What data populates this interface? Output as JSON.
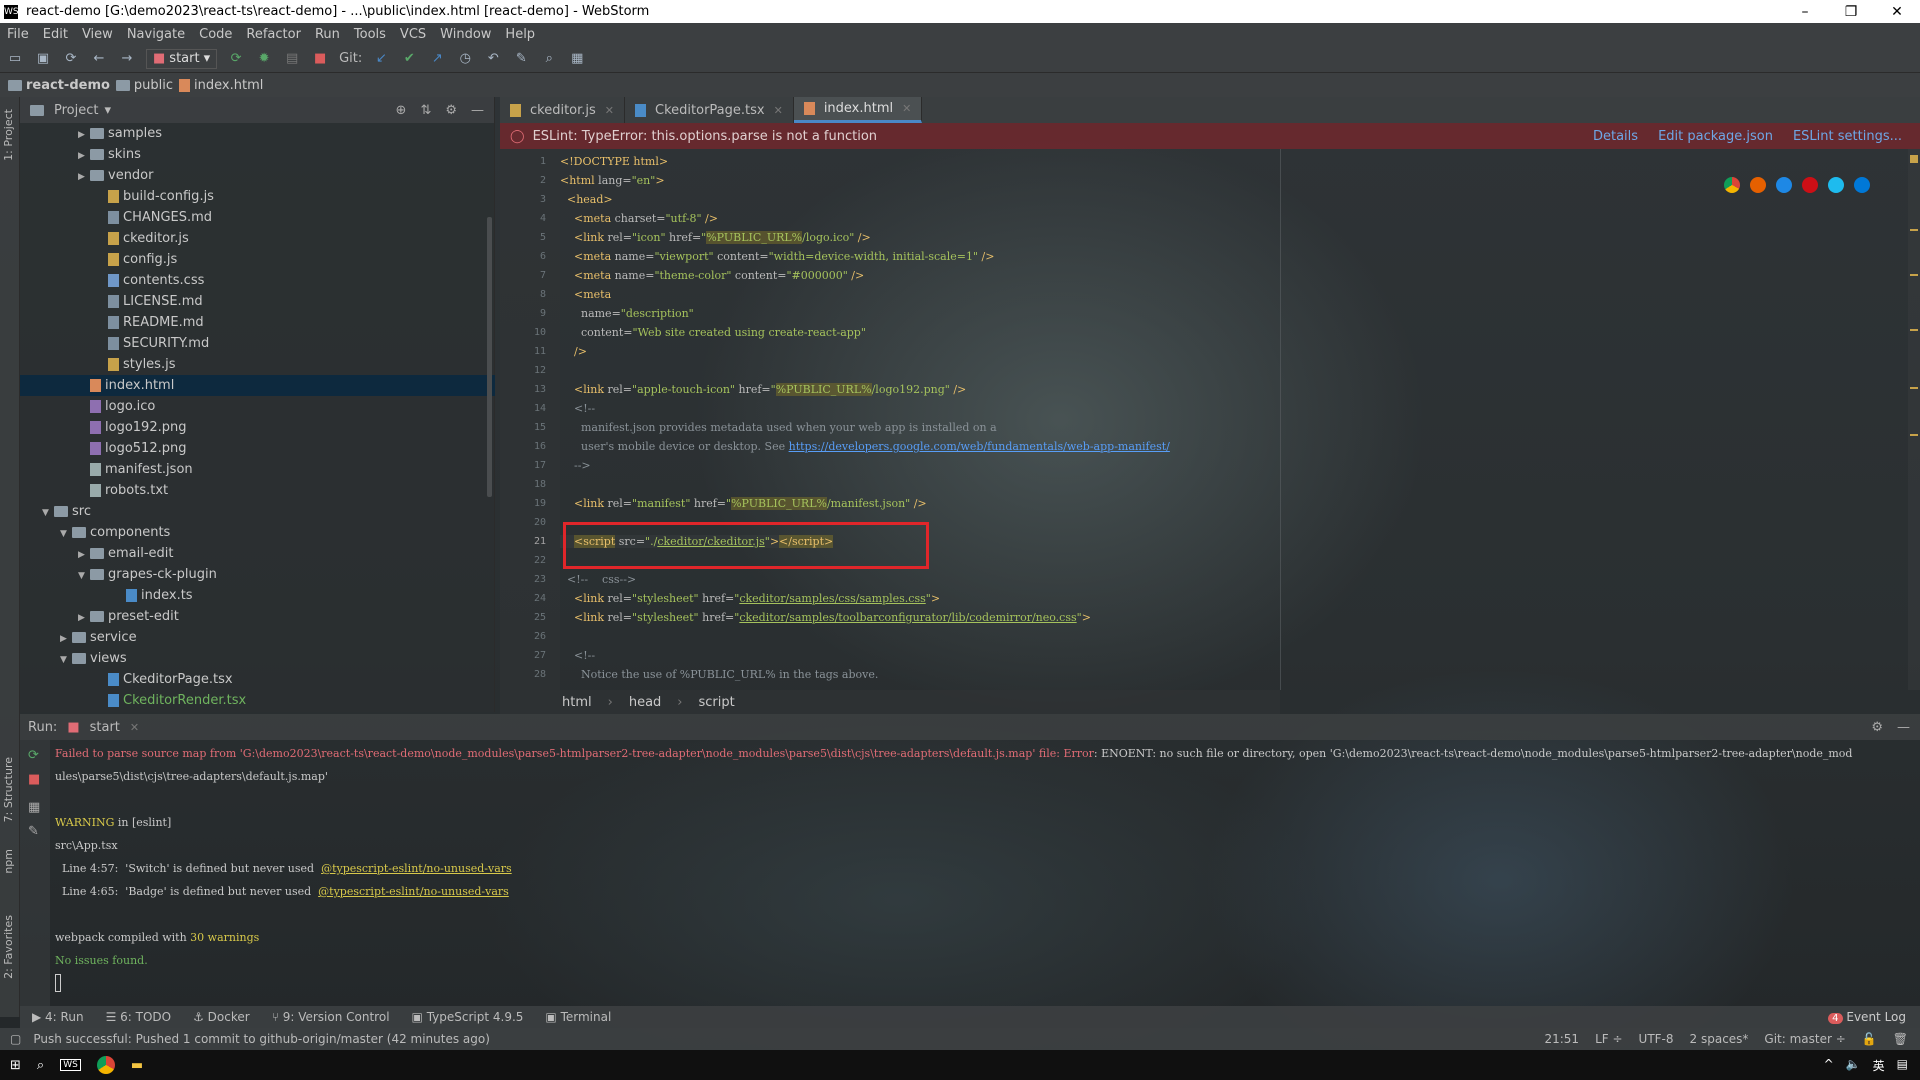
{
  "window": {
    "title": "react-demo [G:\\demo2023\\react-ts\\react-demo] - ...\\public\\index.html [react-demo] - WebStorm",
    "app_icon": "WS"
  },
  "menu": [
    "File",
    "Edit",
    "View",
    "Navigate",
    "Code",
    "Refactor",
    "Run",
    "Tools",
    "VCS",
    "Window",
    "Help"
  ],
  "toolbar": {
    "run_config": "start",
    "git_label": "Git:"
  },
  "breadcrumb": [
    "react-demo",
    "public",
    "index.html"
  ],
  "project": {
    "title": "Project",
    "rows": [
      {
        "label": "samples",
        "type": "folder",
        "depth": 3,
        "arrow": "▶"
      },
      {
        "label": "skins",
        "type": "folder",
        "depth": 3,
        "arrow": "▶"
      },
      {
        "label": "vendor",
        "type": "folder",
        "depth": 3,
        "arrow": "▶"
      },
      {
        "label": "build-config.js",
        "type": "js",
        "depth": 4,
        "arrow": ""
      },
      {
        "label": "CHANGES.md",
        "type": "md",
        "depth": 4,
        "arrow": ""
      },
      {
        "label": "ckeditor.js",
        "type": "js",
        "depth": 4,
        "arrow": ""
      },
      {
        "label": "config.js",
        "type": "js",
        "depth": 4,
        "arrow": ""
      },
      {
        "label": "contents.css",
        "type": "css",
        "depth": 4,
        "arrow": ""
      },
      {
        "label": "LICENSE.md",
        "type": "md",
        "depth": 4,
        "arrow": ""
      },
      {
        "label": "README.md",
        "type": "md",
        "depth": 4,
        "arrow": ""
      },
      {
        "label": "SECURITY.md",
        "type": "md",
        "depth": 4,
        "arrow": ""
      },
      {
        "label": "styles.js",
        "type": "js",
        "depth": 4,
        "arrow": ""
      },
      {
        "label": "index.html",
        "type": "html",
        "depth": 3,
        "arrow": "",
        "selected": true
      },
      {
        "label": "logo.ico",
        "type": "png",
        "depth": 3,
        "arrow": ""
      },
      {
        "label": "logo192.png",
        "type": "png",
        "depth": 3,
        "arrow": ""
      },
      {
        "label": "logo512.png",
        "type": "png",
        "depth": 3,
        "arrow": ""
      },
      {
        "label": "manifest.json",
        "type": "txt",
        "depth": 3,
        "arrow": ""
      },
      {
        "label": "robots.txt",
        "type": "txt",
        "depth": 3,
        "arrow": ""
      },
      {
        "label": "src",
        "type": "folder",
        "depth": 1,
        "arrow": "▼"
      },
      {
        "label": "components",
        "type": "folder",
        "depth": 2,
        "arrow": "▼"
      },
      {
        "label": "email-edit",
        "type": "folder",
        "depth": 3,
        "arrow": "▶"
      },
      {
        "label": "grapes-ck-plugin",
        "type": "folder",
        "depth": 3,
        "arrow": "▼"
      },
      {
        "label": "index.ts",
        "type": "tsx",
        "depth": 5,
        "arrow": ""
      },
      {
        "label": "preset-edit",
        "type": "folder",
        "depth": 3,
        "arrow": "▶"
      },
      {
        "label": "service",
        "type": "folder",
        "depth": 2,
        "arrow": "▶"
      },
      {
        "label": "views",
        "type": "folder",
        "depth": 2,
        "arrow": "▼"
      },
      {
        "label": "CkeditorPage.tsx",
        "type": "tsx",
        "depth": 4,
        "arrow": ""
      },
      {
        "label": "CkeditorRender.tsx",
        "type": "tsx",
        "depth": 4,
        "arrow": ""
      }
    ]
  },
  "tabs": [
    {
      "label": "ckeditor.js",
      "type": "js",
      "active": false
    },
    {
      "label": "CkeditorPage.tsx",
      "type": "tsx",
      "active": false
    },
    {
      "label": "index.html",
      "type": "html",
      "active": true
    }
  ],
  "eslint": {
    "message": "ESLint: TypeError: this.options.parse is not a function",
    "links": [
      "Details",
      "Edit package.json",
      "ESLint settings..."
    ]
  },
  "code_lines": [
    "1",
    "2",
    "3",
    "4",
    "5",
    "6",
    "7",
    "8",
    "9",
    "10",
    "11",
    "12",
    "13",
    "14",
    "15",
    "16",
    "17",
    "18",
    "19",
    "20",
    "21",
    "22",
    "23",
    "24",
    "25",
    "26",
    "27",
    "28"
  ],
  "editor_breadcrumb": [
    "html",
    "head",
    "script"
  ],
  "run": {
    "label": "Run:",
    "config": "start",
    "console": {
      "err1a": "Failed to parse source map from 'G:\\demo2023\\react-ts\\react-demo\\node_modules\\parse5-htmlparser2-tree-adapter\\node_modules\\parse5\\dist\\cjs\\tree-adapters\\default.js.map' file: ",
      "err1b": "Error",
      "err1c": ": ENOENT: no such file or directory, open 'G:\\demo2023\\react-ts\\react-demo\\node_modules\\parse5-htmlparser2-tree-adapter\\node_mod",
      "err2": "ules\\parse5\\dist\\cjs\\tree-adapters\\default.js.map'",
      "warning": "WARNING",
      "warning_rest": " in [eslint]",
      "file": "src\\App.tsx",
      "line1": "  Line 4:57:  'Switch' is defined but never used  ",
      "line1_rule": "@typescript-eslint/no-unused-vars",
      "line2": "  Line 4:65:  'Badge' is defined but never used  ",
      "line2_rule": "@typescript-eslint/no-unused-vars",
      "compiled_a": "webpack compiled with ",
      "compiled_b": "30 warnings",
      "no_issues": "No issues found."
    }
  },
  "bottom_tabs": [
    "4: Run",
    "6: TODO",
    "Docker",
    "9: Version Control",
    "TypeScript 4.9.5",
    "Terminal"
  ],
  "event_log": "Event Log",
  "event_count": "4",
  "status": {
    "message": "Push successful: Pushed 1 commit to github-origin/master (42 minutes ago)",
    "position": "21:51",
    "line_sep": "LF ÷",
    "encoding": "UTF-8",
    "indent": "2 spaces*",
    "git": "Git: master ÷"
  },
  "taskbar": {
    "tray": "英"
  },
  "side_labels": {
    "project": "1: Project",
    "structure": "7: Structure",
    "npm": "npm",
    "favorites": "2: Favorites"
  }
}
